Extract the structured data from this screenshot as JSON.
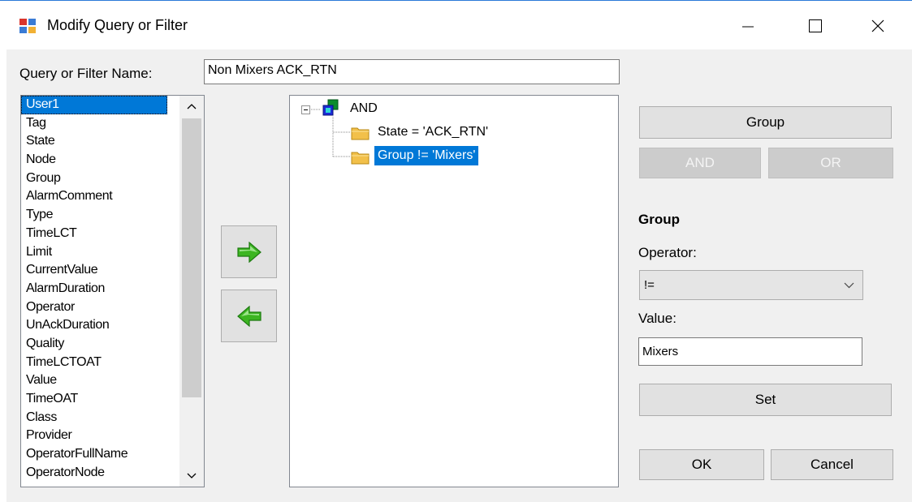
{
  "window": {
    "title": "Modify Query or Filter"
  },
  "form": {
    "name_label": "Query or Filter Name:",
    "name_value": "Non Mixers ACK_RTN"
  },
  "fields": [
    "User1",
    "Tag",
    "State",
    "Node",
    "Group",
    "AlarmComment",
    "Type",
    "TimeLCT",
    "Limit",
    "CurrentValue",
    "AlarmDuration",
    "Operator",
    "UnAckDuration",
    "Quality",
    "TimeLCTOAT",
    "Value",
    "TimeOAT",
    "Class",
    "Provider",
    "OperatorFullName",
    "OperatorNode"
  ],
  "tree": {
    "root": "AND",
    "children": [
      "State = 'ACK_RTN'",
      "Group != 'Mixers'"
    ]
  },
  "right": {
    "group_button": "Group",
    "and_button": "AND",
    "or_button": "OR",
    "section_title": "Group",
    "operator_label": "Operator:",
    "operator_value": "!=",
    "value_label": "Value:",
    "value_value": "Mixers",
    "set_button": "Set",
    "ok_button": "OK",
    "cancel_button": "Cancel"
  },
  "colors": {
    "selection": "#0078d7",
    "arrow_green": "#3cb521",
    "folder": "#f2c04a"
  }
}
